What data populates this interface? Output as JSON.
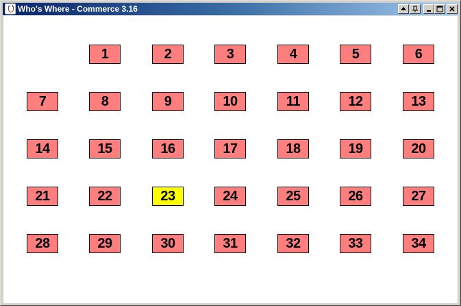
{
  "window": {
    "title": "Who's Where - Commerce 3.16",
    "icon": "java-cup-icon",
    "controls": [
      {
        "name": "scroll-up-button",
        "glyph": "up-triangle-icon"
      },
      {
        "name": "pin-button",
        "glyph": "pin-icon"
      },
      {
        "name": "minimize-button",
        "glyph": "minimize-icon"
      },
      {
        "name": "maximize-button",
        "glyph": "maximize-icon"
      },
      {
        "name": "close-button",
        "glyph": "close-icon"
      }
    ]
  },
  "colors": {
    "seat_default": "#ff7f7f",
    "seat_highlight": "#ffff00",
    "background": "#ffffff",
    "title_start": "#0a246a",
    "title_end": "#a6caf0"
  },
  "seats": {
    "highlighted": "23",
    "rows": [
      [
        "",
        "1",
        "2",
        "3",
        "4",
        "5",
        "6"
      ],
      [
        "7",
        "8",
        "9",
        "10",
        "11",
        "12",
        "13"
      ],
      [
        "14",
        "15",
        "16",
        "17",
        "18",
        "19",
        "20"
      ],
      [
        "21",
        "22",
        "23",
        "24",
        "25",
        "26",
        "27"
      ],
      [
        "28",
        "29",
        "30",
        "31",
        "32",
        "33",
        "34"
      ]
    ]
  }
}
